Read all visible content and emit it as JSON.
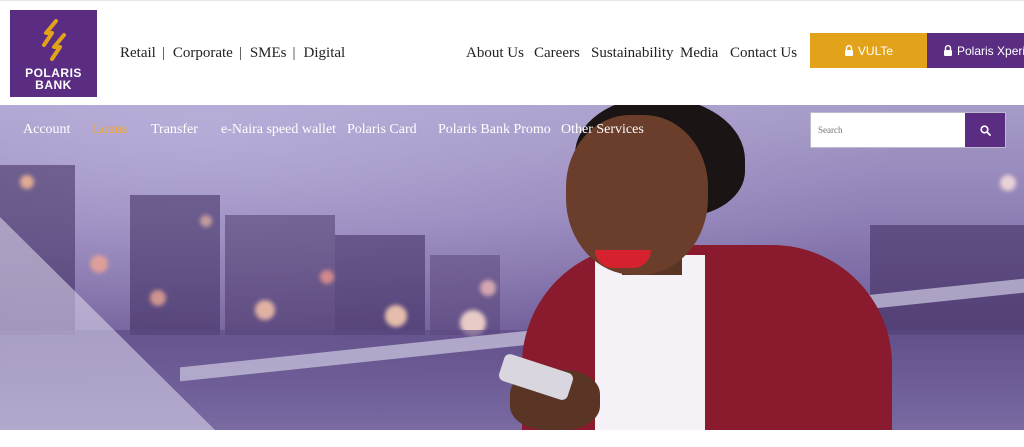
{
  "brand": {
    "name_line1": "POLARIS",
    "name_line2": "BANK",
    "primary_color": "#5a2d82",
    "accent_color": "#e2a31b"
  },
  "header": {
    "segments": [
      "Retail",
      "Corporate",
      "SMEs",
      "Digital"
    ],
    "separator": "|",
    "links": {
      "about": "About Us",
      "careers": "Careers",
      "sustainability": "Sustainability",
      "media": "Media",
      "contact": "Contact Us"
    },
    "buttons": {
      "vulte": "VULTe",
      "xperience": "Polaris Xperience"
    }
  },
  "hero_nav": {
    "account": "Account",
    "loans": "Loans",
    "transfer": "Transfer",
    "enaira": "e-Naira speed wallet",
    "card": "Polaris Card",
    "promo": "Polaris Bank Promo",
    "other": "Other Services",
    "active_color": "#f5a623"
  },
  "search": {
    "placeholder": "Search",
    "icon": "search-icon"
  }
}
